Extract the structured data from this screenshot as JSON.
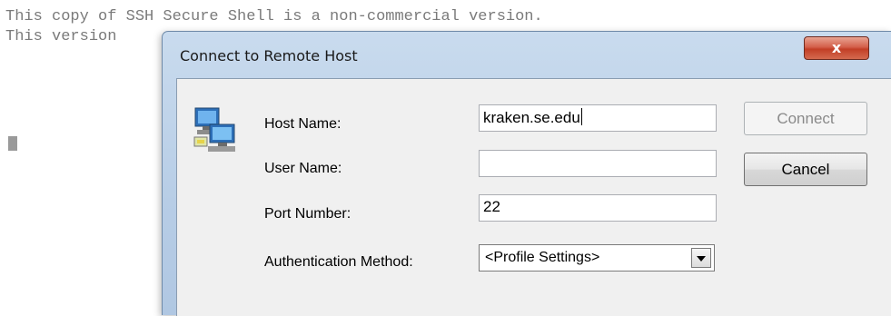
{
  "terminal": {
    "line1": "This copy of SSH Secure Shell is a non-commercial version.",
    "line2": "This version"
  },
  "dialog": {
    "title": "Connect to Remote Host",
    "close_label": "x",
    "icon": "computers-network-icon",
    "fields": {
      "host_label": "Host Name:",
      "host_value": "kraken.se.edu",
      "user_label": "User Name:",
      "user_value": "",
      "port_label": "Port Number:",
      "port_value": "22",
      "auth_label": "Authentication Method:",
      "auth_value": "<Profile Settings>"
    },
    "buttons": {
      "connect_label": "Connect",
      "cancel_label": "Cancel"
    }
  },
  "colors": {
    "frame": "#b7cde6",
    "close_button": "#c23f26",
    "disabled_text": "#8a8a8a"
  }
}
